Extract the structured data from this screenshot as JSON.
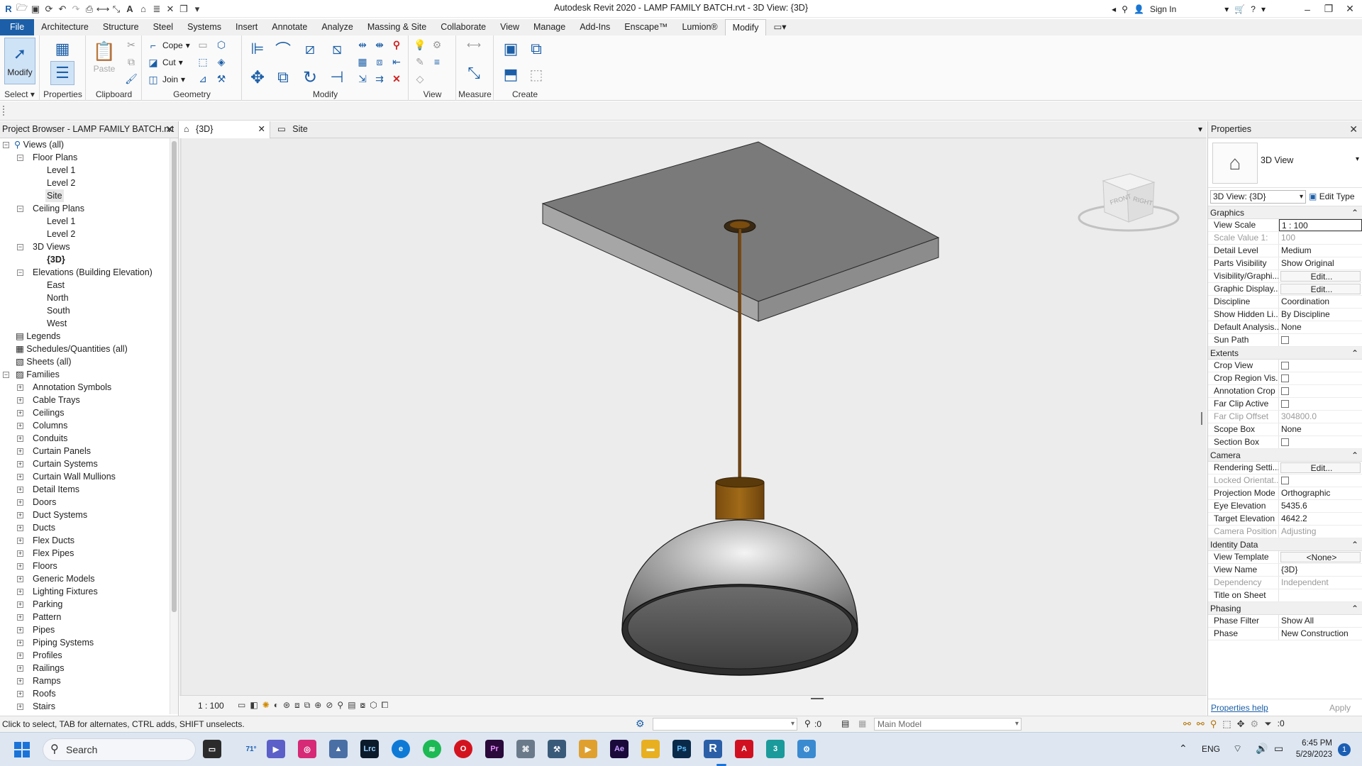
{
  "window": {
    "title": "Autodesk Revit 2020 - LAMP FAMILY BATCH.rvt - 3D View: {3D}",
    "sign_in": "Sign In"
  },
  "ribbon_tabs": [
    "File",
    "Architecture",
    "Structure",
    "Steel",
    "Systems",
    "Insert",
    "Annotate",
    "Analyze",
    "Massing & Site",
    "Collaborate",
    "View",
    "Manage",
    "Add-Ins",
    "Enscape™",
    "Lumion®",
    "Modify"
  ],
  "ribbon": {
    "modify_label": "Modify",
    "select_label": "Select",
    "properties_label": "Properties",
    "paste_label": "Paste",
    "clipboard_label": "Clipboard",
    "cope_label": "Cope",
    "cut_label": "Cut",
    "join_label": "Join",
    "geometry_label": "Geometry",
    "modify_panel_label": "Modify",
    "view_label": "View",
    "measure_label": "Measure",
    "create_label": "Create"
  },
  "browser": {
    "title": "Project Browser - LAMP FAMILY BATCH.rvt",
    "views_all": "Views (all)",
    "floor_plans": "Floor Plans",
    "fp_level1": "Level 1",
    "fp_level2": "Level 2",
    "fp_site": "Site",
    "ceiling_plans": "Ceiling Plans",
    "cp_level1": "Level 1",
    "cp_level2": "Level 2",
    "views_3d": "3D Views",
    "view_3d": "{3D}",
    "elevations": "Elevations (Building Elevation)",
    "el_east": "East",
    "el_north": "North",
    "el_south": "South",
    "el_west": "West",
    "legends": "Legends",
    "schedules": "Schedules/Quantities (all)",
    "sheets": "Sheets (all)",
    "families": "Families",
    "family_items": [
      "Annotation Symbols",
      "Cable Trays",
      "Ceilings",
      "Columns",
      "Conduits",
      "Curtain Panels",
      "Curtain Systems",
      "Curtain Wall Mullions",
      "Detail Items",
      "Doors",
      "Duct Systems",
      "Ducts",
      "Flex Ducts",
      "Flex Pipes",
      "Floors",
      "Generic Models",
      "Lighting Fixtures",
      "Parking",
      "Pattern",
      "Pipes",
      "Piping Systems",
      "Profiles",
      "Railings",
      "Ramps",
      "Roofs",
      "Stairs"
    ]
  },
  "view_tabs": {
    "tab1": "{3D}",
    "tab2": "Site"
  },
  "viewcube": {
    "front": "FRONT",
    "right": "RIGHT"
  },
  "view_bar": {
    "scale": "1 : 100"
  },
  "properties": {
    "title": "Properties",
    "type_name": "3D View",
    "view_selector": "3D View: {3D}",
    "edit_type": "Edit Type",
    "sections": {
      "graphics": "Graphics",
      "extents": "Extents",
      "camera": "Camera",
      "identity": "Identity Data",
      "phasing": "Phasing"
    },
    "graphics": [
      {
        "name": "View Scale",
        "value": "1 : 100"
      },
      {
        "name": "Scale Value    1:",
        "value": "100"
      },
      {
        "name": "Detail Level",
        "value": "Medium"
      },
      {
        "name": "Parts Visibility",
        "value": "Show Original"
      },
      {
        "name": "Visibility/Graphi...",
        "value": "Edit..."
      },
      {
        "name": "Graphic Display...",
        "value": "Edit..."
      },
      {
        "name": "Discipline",
        "value": "Coordination"
      },
      {
        "name": "Show Hidden Li...",
        "value": "By Discipline"
      },
      {
        "name": "Default Analysis...",
        "value": "None"
      },
      {
        "name": "Sun Path",
        "value": ""
      }
    ],
    "extents": [
      {
        "name": "Crop View",
        "value": ""
      },
      {
        "name": "Crop Region Vis...",
        "value": ""
      },
      {
        "name": "Annotation Crop",
        "value": ""
      },
      {
        "name": "Far Clip Active",
        "value": ""
      },
      {
        "name": "Far Clip Offset",
        "value": "304800.0"
      },
      {
        "name": "Scope Box",
        "value": "None"
      },
      {
        "name": "Section Box",
        "value": ""
      }
    ],
    "camera": [
      {
        "name": "Rendering Setti...",
        "value": "Edit..."
      },
      {
        "name": "Locked Orientat...",
        "value": ""
      },
      {
        "name": "Projection Mode",
        "value": "Orthographic"
      },
      {
        "name": "Eye Elevation",
        "value": "5435.6"
      },
      {
        "name": "Target Elevation",
        "value": "4642.2"
      },
      {
        "name": "Camera Position",
        "value": "Adjusting"
      }
    ],
    "identity": [
      {
        "name": "View Template",
        "value": "<None>"
      },
      {
        "name": "View Name",
        "value": "{3D}"
      },
      {
        "name": "Dependency",
        "value": "Independent"
      },
      {
        "name": "Title on Sheet",
        "value": ""
      }
    ],
    "phasing": [
      {
        "name": "Phase Filter",
        "value": "Show All"
      },
      {
        "name": "Phase",
        "value": "New Construction"
      }
    ],
    "help_link": "Properties help",
    "apply": "Apply"
  },
  "status": {
    "hint": "Click to select, TAB for alternates, CTRL adds, SHIFT unselects.",
    "count": ":0",
    "model": "Main Model",
    "filter_count": ":0"
  },
  "taskbar": {
    "search": "Search",
    "weather": "71°",
    "language": "ENG",
    "time": "6:45 PM",
    "date": "5/29/2023",
    "badge": "1"
  },
  "colors": {
    "accent": "#1c5fa8",
    "canvas": "#ececec",
    "lamp_rod": "#7a4a10",
    "lamp_collar": "#8a5a12"
  }
}
